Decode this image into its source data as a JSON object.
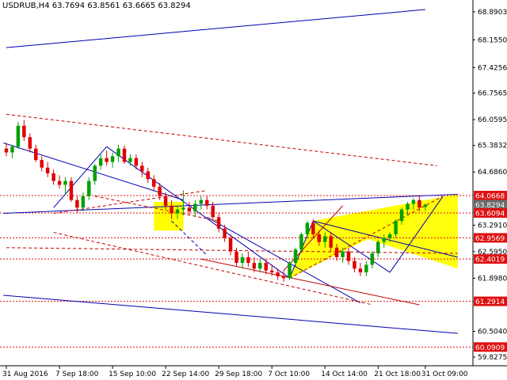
{
  "header": {
    "info_line": "USDRUB,H4  63.7694 63.8561 63.6665 63.8294"
  },
  "colors": {
    "background": "#ffffff",
    "axis": "#000000",
    "bull_candle": "#00a000",
    "bear_candle": "#e00000",
    "trendline": "#0000b0",
    "dashed_red": "#c00000",
    "dashed_blue": "#0000c0",
    "triangle_fill": "#ffff00",
    "level_red_label": "#e01010",
    "level_current_label": "#6a6a6a"
  },
  "chart_data": {
    "type": "candlestick",
    "title": "USDRUB,H4",
    "symbol": "USDRUB",
    "timeframe": "H4",
    "last_bar": {
      "open": 63.7694,
      "high": 63.8561,
      "low": 63.6665,
      "close": 63.8294
    },
    "ylim": [
      59.6,
      69.2
    ],
    "y_ticks": [
      "68.8903",
      "68.1550",
      "67.4256",
      "66.7565",
      "66.0595",
      "65.3832",
      "64.6860",
      "63.2910",
      "62.5950",
      "61.8980",
      "60.5040",
      "59.8275"
    ],
    "x_ticks": [
      "31 Aug 2016",
      "7 Sep 18:00",
      "15 Sep 10:00",
      "22 Sep 14:00",
      "29 Sep 18:00",
      "7 Oct 10:00",
      "14 Oct 14:00",
      "21 Oct 18:00",
      "31 Oct 09:00"
    ],
    "levels": [
      {
        "value": 64.0668,
        "label": "64.0668",
        "kind": "red"
      },
      {
        "value": 63.8294,
        "label": "63.8294",
        "kind": "current"
      },
      {
        "value": 63.6094,
        "label": "63.6094",
        "kind": "red"
      },
      {
        "value": 62.9569,
        "label": "62.9569",
        "kind": "red"
      },
      {
        "value": 62.4019,
        "label": "62.4019",
        "kind": "red"
      },
      {
        "value": 61.2914,
        "label": "61.2914",
        "kind": "red"
      },
      {
        "value": 60.0909,
        "label": "60.0909",
        "kind": "red"
      }
    ],
    "candles": [
      {
        "o": 65.3,
        "h": 65.45,
        "l": 65.1,
        "c": 65.2
      },
      {
        "o": 65.2,
        "h": 65.4,
        "l": 65.05,
        "c": 65.35
      },
      {
        "o": 65.35,
        "h": 66.0,
        "l": 65.3,
        "c": 65.9
      },
      {
        "o": 65.9,
        "h": 66.05,
        "l": 65.5,
        "c": 65.6
      },
      {
        "o": 65.6,
        "h": 65.7,
        "l": 65.2,
        "c": 65.3
      },
      {
        "o": 65.3,
        "h": 65.4,
        "l": 64.95,
        "c": 65.0
      },
      {
        "o": 65.0,
        "h": 65.1,
        "l": 64.7,
        "c": 64.8
      },
      {
        "o": 64.8,
        "h": 64.95,
        "l": 64.55,
        "c": 64.65
      },
      {
        "o": 64.65,
        "h": 64.75,
        "l": 64.35,
        "c": 64.45
      },
      {
        "o": 64.45,
        "h": 64.6,
        "l": 64.25,
        "c": 64.35
      },
      {
        "o": 64.35,
        "h": 64.55,
        "l": 64.1,
        "c": 64.45
      },
      {
        "o": 64.45,
        "h": 64.55,
        "l": 63.9,
        "c": 63.95
      },
      {
        "o": 63.95,
        "h": 64.05,
        "l": 63.6,
        "c": 63.75
      },
      {
        "o": 63.75,
        "h": 64.15,
        "l": 63.65,
        "c": 64.05
      },
      {
        "o": 64.05,
        "h": 64.55,
        "l": 63.95,
        "c": 64.45
      },
      {
        "o": 64.45,
        "h": 64.9,
        "l": 64.35,
        "c": 64.85
      },
      {
        "o": 64.85,
        "h": 65.15,
        "l": 64.75,
        "c": 65.05
      },
      {
        "o": 65.05,
        "h": 65.25,
        "l": 64.85,
        "c": 64.95
      },
      {
        "o": 64.95,
        "h": 65.2,
        "l": 64.8,
        "c": 65.1
      },
      {
        "o": 65.1,
        "h": 65.4,
        "l": 64.95,
        "c": 65.3
      },
      {
        "o": 65.3,
        "h": 65.38,
        "l": 64.9,
        "c": 64.95
      },
      {
        "o": 64.95,
        "h": 65.15,
        "l": 64.85,
        "c": 65.05
      },
      {
        "o": 65.05,
        "h": 65.15,
        "l": 64.75,
        "c": 64.85
      },
      {
        "o": 64.85,
        "h": 64.95,
        "l": 64.55,
        "c": 64.7
      },
      {
        "o": 64.7,
        "h": 64.8,
        "l": 64.4,
        "c": 64.5
      },
      {
        "o": 64.5,
        "h": 64.6,
        "l": 64.2,
        "c": 64.3
      },
      {
        "o": 64.3,
        "h": 64.4,
        "l": 63.95,
        "c": 64.05
      },
      {
        "o": 64.05,
        "h": 64.15,
        "l": 63.7,
        "c": 63.8
      },
      {
        "o": 63.8,
        "h": 63.95,
        "l": 63.45,
        "c": 63.6
      },
      {
        "o": 63.6,
        "h": 63.8,
        "l": 63.45,
        "c": 63.7
      },
      {
        "o": 63.7,
        "h": 64.2,
        "l": 63.55,
        "c": 63.75
      },
      {
        "o": 63.75,
        "h": 63.9,
        "l": 63.55,
        "c": 63.65
      },
      {
        "o": 63.65,
        "h": 63.95,
        "l": 63.5,
        "c": 63.85
      },
      {
        "o": 63.85,
        "h": 64.05,
        "l": 63.7,
        "c": 63.95
      },
      {
        "o": 63.95,
        "h": 64.05,
        "l": 63.7,
        "c": 63.8
      },
      {
        "o": 63.8,
        "h": 63.9,
        "l": 63.4,
        "c": 63.5
      },
      {
        "o": 63.5,
        "h": 63.6,
        "l": 63.1,
        "c": 63.2
      },
      {
        "o": 63.2,
        "h": 63.3,
        "l": 62.85,
        "c": 62.95
      },
      {
        "o": 62.95,
        "h": 63.05,
        "l": 62.5,
        "c": 62.6
      },
      {
        "o": 62.6,
        "h": 62.7,
        "l": 62.2,
        "c": 62.3
      },
      {
        "o": 62.3,
        "h": 62.55,
        "l": 62.15,
        "c": 62.45
      },
      {
        "o": 62.45,
        "h": 62.6,
        "l": 62.2,
        "c": 62.3
      },
      {
        "o": 62.3,
        "h": 62.45,
        "l": 62.05,
        "c": 62.15
      },
      {
        "o": 62.15,
        "h": 62.4,
        "l": 62.05,
        "c": 62.3
      },
      {
        "o": 62.3,
        "h": 62.4,
        "l": 62.0,
        "c": 62.1
      },
      {
        "o": 62.1,
        "h": 62.25,
        "l": 61.95,
        "c": 62.05
      },
      {
        "o": 62.05,
        "h": 62.15,
        "l": 61.85,
        "c": 61.95
      },
      {
        "o": 61.95,
        "h": 62.1,
        "l": 61.8,
        "c": 61.9
      },
      {
        "o": 61.9,
        "h": 62.35,
        "l": 61.85,
        "c": 62.3
      },
      {
        "o": 62.3,
        "h": 62.7,
        "l": 62.2,
        "c": 62.65
      },
      {
        "o": 62.65,
        "h": 63.1,
        "l": 62.55,
        "c": 63.05
      },
      {
        "o": 63.05,
        "h": 63.4,
        "l": 62.95,
        "c": 63.35
      },
      {
        "o": 63.35,
        "h": 63.45,
        "l": 62.95,
        "c": 63.05
      },
      {
        "o": 63.05,
        "h": 63.15,
        "l": 62.75,
        "c": 62.85
      },
      {
        "o": 62.85,
        "h": 63.1,
        "l": 62.7,
        "c": 63.0
      },
      {
        "o": 63.0,
        "h": 63.1,
        "l": 62.6,
        "c": 62.7
      },
      {
        "o": 62.7,
        "h": 62.8,
        "l": 62.35,
        "c": 62.45
      },
      {
        "o": 62.45,
        "h": 62.7,
        "l": 62.3,
        "c": 62.6
      },
      {
        "o": 62.6,
        "h": 62.7,
        "l": 62.25,
        "c": 62.35
      },
      {
        "o": 62.35,
        "h": 62.45,
        "l": 62.05,
        "c": 62.15
      },
      {
        "o": 62.15,
        "h": 62.3,
        "l": 61.95,
        "c": 62.05
      },
      {
        "o": 62.05,
        "h": 62.35,
        "l": 61.95,
        "c": 62.25
      },
      {
        "o": 62.25,
        "h": 62.6,
        "l": 62.15,
        "c": 62.55
      },
      {
        "o": 62.55,
        "h": 62.9,
        "l": 62.45,
        "c": 62.85
      },
      {
        "o": 62.85,
        "h": 63.05,
        "l": 62.7,
        "c": 62.95
      },
      {
        "o": 62.95,
        "h": 63.1,
        "l": 62.85,
        "c": 63.05
      },
      {
        "o": 63.05,
        "h": 63.45,
        "l": 62.95,
        "c": 63.4
      },
      {
        "o": 63.4,
        "h": 63.75,
        "l": 63.3,
        "c": 63.7
      },
      {
        "o": 63.7,
        "h": 63.9,
        "l": 63.55,
        "c": 63.85
      },
      {
        "o": 63.85,
        "h": 64.0,
        "l": 63.7,
        "c": 63.95
      },
      {
        "o": 63.95,
        "h": 64.05,
        "l": 63.65,
        "c": 63.75
      },
      {
        "o": 63.7694,
        "h": 63.8561,
        "l": 63.6665,
        "c": 63.8294
      }
    ],
    "trendlines": [
      {
        "x1": 0,
        "y1": 67.95,
        "x2": 71,
        "y2": 68.95,
        "style": "solid",
        "color": "trendline"
      },
      {
        "x1": -0.5,
        "y1": 65.45,
        "x2": 30,
        "y2": 63.95,
        "style": "solid",
        "color": "trendline"
      },
      {
        "x1": -0.5,
        "y1": 63.6,
        "x2": 76.5,
        "y2": 64.1,
        "style": "solid",
        "color": "trendline"
      },
      {
        "x1": 0,
        "y1": 62.7,
        "x2": 76.5,
        "y2": 62.55,
        "style": "dashed",
        "color": "dashed_red"
      },
      {
        "x1": -0.5,
        "y1": 61.45,
        "x2": 76.5,
        "y2": 60.45,
        "style": "solid",
        "color": "trendline"
      },
      {
        "x1": 0,
        "y1": 66.2,
        "x2": 73,
        "y2": 64.85,
        "style": "dashed",
        "color": "dashed_red"
      },
      {
        "x1": 8,
        "y1": 63.75,
        "x2": 17,
        "y2": 65.35,
        "style": "solid",
        "color": "trendline"
      },
      {
        "x1": 17,
        "y1": 65.35,
        "x2": 31,
        "y2": 63.8,
        "style": "solid",
        "color": "trendline"
      },
      {
        "x1": 31,
        "y1": 63.8,
        "x2": 48,
        "y2": 61.9,
        "style": "solid",
        "color": "trendline"
      },
      {
        "x1": 48,
        "y1": 61.9,
        "x2": 52,
        "y2": 63.4,
        "style": "solid",
        "color": "trendline"
      },
      {
        "x1": 52,
        "y1": 63.4,
        "x2": 65,
        "y2": 62.05,
        "style": "solid",
        "color": "trendline"
      },
      {
        "x1": 65,
        "y1": 62.05,
        "x2": 74,
        "y2": 64.05,
        "style": "solid",
        "color": "trendline"
      },
      {
        "x1": 34,
        "y1": 63.5,
        "x2": 60,
        "y2": 61.25,
        "style": "solid",
        "color": "trendline"
      },
      {
        "x1": 52,
        "y1": 63.4,
        "x2": 76.5,
        "y2": 62.45,
        "style": "solid",
        "color": "trendline"
      },
      {
        "x1": 33,
        "y1": 62.4,
        "x2": 70,
        "y2": 61.2,
        "style": "solid",
        "color": "dashed_red"
      },
      {
        "x1": 47,
        "y1": 62.1,
        "x2": 57,
        "y2": 63.8,
        "style": "solid",
        "color": "dashed_red"
      },
      {
        "x1": 15,
        "y1": 64.05,
        "x2": 36,
        "y2": 63.4,
        "style": "dashed",
        "color": "dashed_red"
      },
      {
        "x1": 8,
        "y1": 63.6,
        "x2": 34,
        "y2": 64.2,
        "style": "dashed",
        "color": "dashed_red"
      },
      {
        "x1": 8,
        "y1": 63.1,
        "x2": 62,
        "y2": 61.2,
        "style": "dashed",
        "color": "dashed_red"
      },
      {
        "x1": 48,
        "y1": 61.9,
        "x2": 74,
        "y2": 64.05,
        "style": "dashed",
        "color": "dashed_red"
      },
      {
        "x1": 28,
        "y1": 63.4,
        "x2": 34,
        "y2": 62.5,
        "style": "dashed",
        "color": "dashed_blue"
      }
    ],
    "triangles": [
      {
        "points": [
          [
            48,
            61.9
          ],
          [
            52,
            63.4
          ],
          [
            76.5,
            64.1
          ]
        ]
      },
      {
        "points": [
          [
            52,
            63.4
          ],
          [
            76.5,
            62.15
          ],
          [
            76.5,
            64.1
          ]
        ]
      }
    ],
    "rectangles": [
      {
        "x1": 25,
        "y1": 63.15,
        "x2": 30,
        "y2": 63.9
      }
    ],
    "x_tick_positions": [
      0,
      9,
      18,
      27,
      36,
      45,
      54,
      63,
      71
    ],
    "x_max": 78
  }
}
